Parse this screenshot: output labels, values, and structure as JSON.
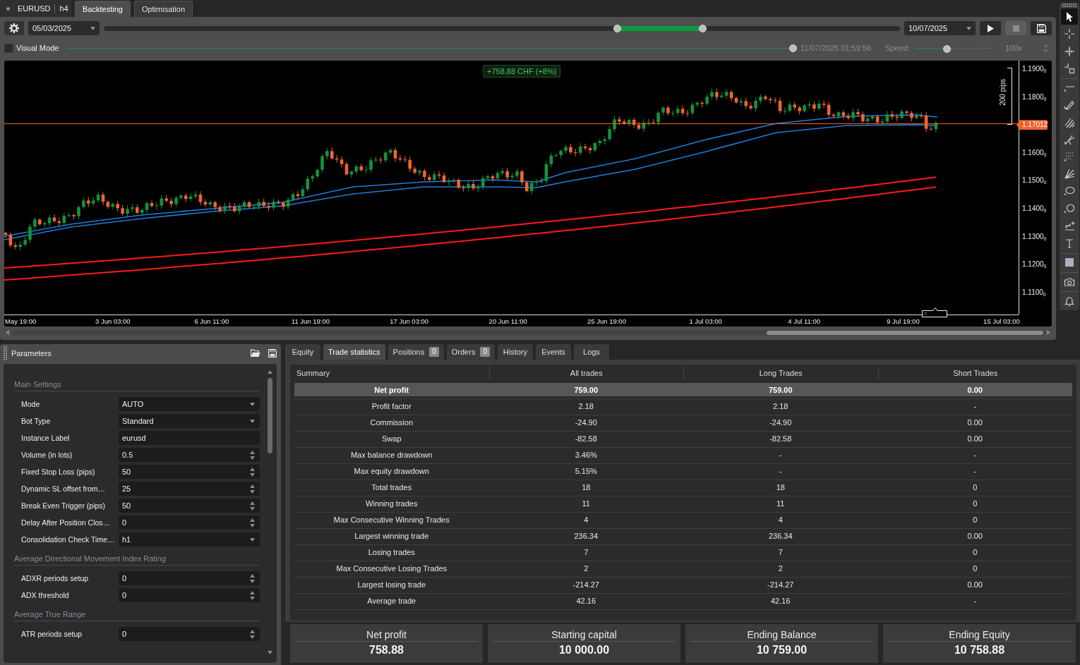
{
  "symbol_tab": {
    "symbol": "EURUSD",
    "timeframe": "h4"
  },
  "tabs": [
    {
      "label": "Backtesting",
      "selected": true
    },
    {
      "label": "Optimisation",
      "selected": false
    }
  ],
  "backtest_controls": {
    "start_date": "05/03/2025",
    "period_handles": [
      {
        "level": 0.645
      },
      {
        "level": 0.752
      }
    ],
    "end_date": "10/07/2025",
    "buttons": [
      {
        "kind": "play",
        "disabled": false
      },
      {
        "kind": "stop",
        "disabled": true
      },
      {
        "kind": "save",
        "disabled": false
      }
    ]
  },
  "visual_mode": {
    "label": "Visual Mode",
    "checked": false
  },
  "playback": {
    "level": 1,
    "timestamp": "11/07/2025 01:59:56",
    "speed_label": "Speed:",
    "speed": {
      "level": 0.41
    },
    "speed_reading": "100x"
  },
  "chart": {
    "profit_badge": "+758.88 CHF (+8%)",
    "measure_label": "200 pips",
    "price_axis": [
      {
        "kind": "tick",
        "text": "1.1900$_{0}$"
      },
      {
        "kind": "tick",
        "text": "1.1800$_{0}$"
      },
      {
        "kind": "current",
        "text": "1.17012"
      },
      {
        "kind": "tick",
        "text": "1.1600$_{0}$"
      },
      {
        "kind": "tick",
        "text": "1.1500$_{0}$"
      },
      {
        "kind": "tick",
        "text": "1.1400$_{0}$"
      },
      {
        "kind": "tick",
        "text": "1.1300$_{0}$"
      },
      {
        "kind": "tick",
        "text": "1.1200$_{0}$"
      },
      {
        "kind": "tick",
        "text": "1.1100$_{0}$"
      }
    ],
    "time_axis": [
      "May 19:00",
      "3 Jun 03:00",
      "6 Jun 11:00",
      "11 Jun 19:00",
      "17 Jun 03:00",
      "20 Jun 11:00",
      "25 Jun 19:00",
      "1 Jul 03:00",
      "4 Jul 11:00",
      "9 Jul 19:00",
      "15 Jul 03:00"
    ]
  },
  "parameters": {
    "title": "Parameters",
    "groups": [
      {
        "title": "Main Settings",
        "fields": [
          {
            "label": "Mode",
            "kind": "dropdown",
            "value": "AUTO"
          },
          {
            "label": "Bot Type",
            "kind": "dropdown",
            "value": "Standard"
          },
          {
            "label": "Instance Label",
            "kind": "text",
            "value": "eurusd"
          },
          {
            "label": "Volume (in lots)",
            "kind": "number",
            "value": "0.5"
          },
          {
            "label": "Fixed Stop Loss (pips)",
            "kind": "number",
            "value": "50"
          },
          {
            "label": "Dynamic SL offset from…",
            "kind": "number",
            "value": "25"
          },
          {
            "label": "Break Even Trigger (pips)",
            "kind": "number",
            "value": "50"
          },
          {
            "label": "Delay After Position Clos…",
            "kind": "number",
            "value": "0"
          },
          {
            "label": "Consolidation Check Time…",
            "kind": "dropdown",
            "value": "h1"
          }
        ]
      },
      {
        "title": "Average Directional Movement Index Rating",
        "fields": [
          {
            "label": "ADXR periods setup",
            "kind": "number",
            "value": "0"
          },
          {
            "label": "ADX threshold",
            "kind": "number",
            "value": "0"
          }
        ]
      },
      {
        "title": "Average True Range",
        "fields": [
          {
            "label": "ATR periods setup",
            "kind": "number",
            "value": "0"
          }
        ]
      }
    ]
  },
  "results": {
    "tabs": [
      {
        "label": "Equity",
        "selected": false
      },
      {
        "label": "Trade statistics",
        "selected": true
      },
      {
        "label": "Positions",
        "count": "0",
        "selected": false
      },
      {
        "label": "Orders",
        "count": "0",
        "selected": false
      },
      {
        "label": "History",
        "selected": false
      },
      {
        "label": "Events",
        "selected": false
      },
      {
        "label": "Logs",
        "selected": false
      }
    ],
    "table": {
      "columns": [
        "Summary",
        "All trades",
        "Long Trades",
        "Short Trades"
      ],
      "rows": [
        {
          "cells": [
            "Net profit",
            "759.00",
            "759.00",
            "0.00"
          ],
          "selected": true
        },
        {
          "cells": [
            "Profit factor",
            "2.18",
            "2.18",
            "-"
          ],
          "selected": false
        },
        {
          "cells": [
            "Commission",
            "-24.90",
            "-24.90",
            "0.00"
          ],
          "selected": false
        },
        {
          "cells": [
            "Swap",
            "-82.58",
            "-82.58",
            "0.00"
          ],
          "selected": false
        },
        {
          "cells": [
            "Max balance drawdown",
            "3.46%",
            "-",
            "-"
          ],
          "selected": false
        },
        {
          "cells": [
            "Max equity drawdown",
            "5.15%",
            "-",
            "-"
          ],
          "selected": false
        },
        {
          "cells": [
            "Total trades",
            "18",
            "18",
            "0"
          ],
          "selected": false
        },
        {
          "cells": [
            "Winning trades",
            "11",
            "11",
            "0"
          ],
          "selected": false
        },
        {
          "cells": [
            "Max Consecutive Winning Trades",
            "4",
            "4",
            "0"
          ],
          "selected": false
        },
        {
          "cells": [
            "Largest winning trade",
            "236.34",
            "236.34",
            "0.00"
          ],
          "selected": false
        },
        {
          "cells": [
            "Losing trades",
            "7",
            "7",
            "0"
          ],
          "selected": false
        },
        {
          "cells": [
            "Max Consecutive Losing Trades",
            "2",
            "2",
            "0"
          ],
          "selected": false
        },
        {
          "cells": [
            "Largest losing trade",
            "-214.27",
            "-214.27",
            "0.00"
          ],
          "selected": false
        },
        {
          "cells": [
            "Average trade",
            "42.16",
            "42.16",
            "-"
          ],
          "selected": false
        }
      ]
    },
    "summary_cards": [
      {
        "title": "Net profit",
        "value": "758.88"
      },
      {
        "title": "Starting capital",
        "value": "10 000.00"
      },
      {
        "title": "Ending Balance",
        "value": "10 759.00"
      },
      {
        "title": "Ending Equity",
        "value": "10 758.88"
      }
    ]
  },
  "tool_groups": [
    {
      "tools": [
        {
          "kind": "cursor",
          "selected": true
        },
        {
          "kind": "crosshair",
          "selected": false
        },
        {
          "kind": "crosshair_ticks",
          "selected": false
        },
        {
          "kind": "crosshair_box",
          "selected": false
        }
      ]
    },
    {
      "tools": [
        {
          "kind": "hline",
          "selected": false
        },
        {
          "kind": "pencil",
          "selected": false
        },
        {
          "kind": "diagonals",
          "selected": false
        },
        {
          "kind": "pitchfork",
          "selected": false
        },
        {
          "kind": "dotted",
          "selected": false
        },
        {
          "kind": "fan",
          "selected": false
        },
        {
          "kind": "ellipse",
          "selected": false
        },
        {
          "kind": "circle",
          "selected": false
        },
        {
          "kind": "line_plus",
          "selected": false
        },
        {
          "kind": "text",
          "selected": false
        }
      ]
    },
    {
      "tools": [
        {
          "kind": "square",
          "selected": false
        }
      ]
    },
    {
      "tools": [
        {
          "kind": "camera",
          "selected": false
        }
      ]
    },
    {
      "tools": [
        {
          "kind": "bell",
          "selected": false
        }
      ]
    }
  ]
}
